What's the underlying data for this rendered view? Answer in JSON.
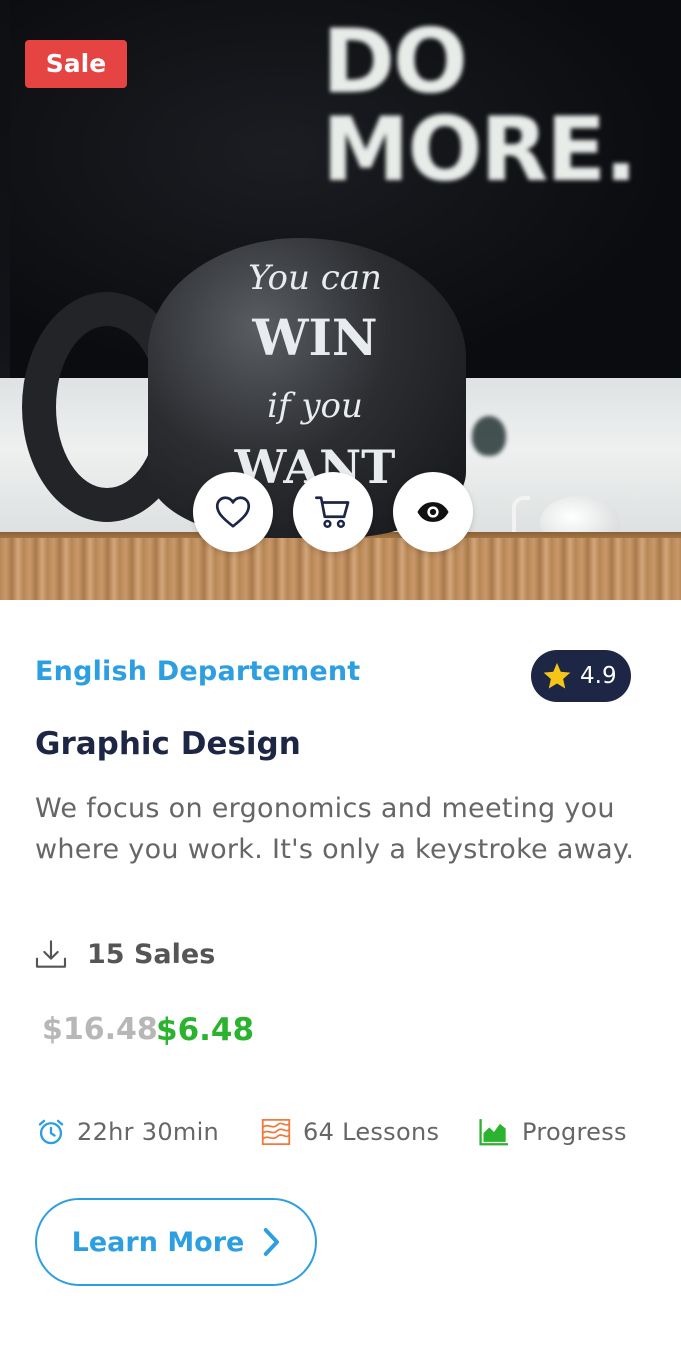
{
  "hero": {
    "sale_badge": "Sale",
    "screen_text_line1": "DO",
    "screen_text_line2": "MORE.",
    "mug_text": [
      "You can",
      "WIN",
      "if you",
      "WANT"
    ]
  },
  "actions": [
    {
      "icon": "heart-icon"
    },
    {
      "icon": "cart-icon"
    },
    {
      "icon": "eye-icon"
    }
  ],
  "course": {
    "department": "English Departement",
    "rating": "4.9",
    "title": "Graphic Design",
    "description": "We focus on ergonomics and meeting you where you work. It's only a keystroke away.",
    "sales": "15 Sales",
    "price_old": "$16.48",
    "price_new": "$6.48",
    "duration": "22hr 30min",
    "lessons": "64 Lessons",
    "progress": "Progress",
    "cta": "Learn More"
  },
  "colors": {
    "accent": "#2d9fe1",
    "sale": "#e64343",
    "rating_bg": "#1e2645",
    "star": "#f5c518",
    "price_new": "#2bb32f",
    "price_old": "#b7b7b7",
    "lessons_icon": "#f07a3c",
    "progress_icon": "#2bb32f"
  }
}
